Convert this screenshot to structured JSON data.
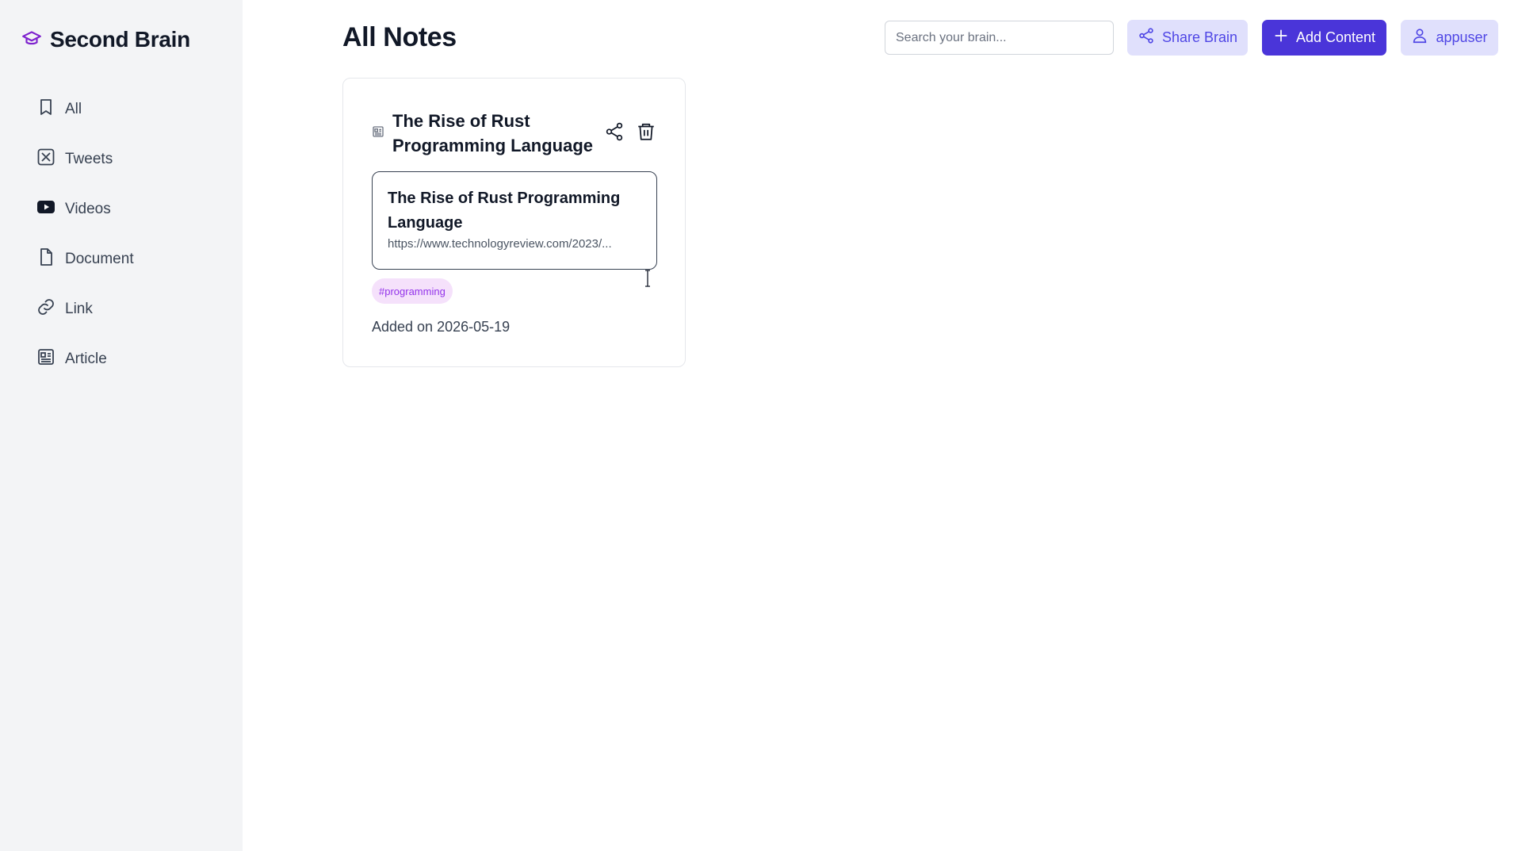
{
  "sidebar": {
    "brand": "Second Brain",
    "items": [
      {
        "label": "All",
        "icon": "bookmark-icon"
      },
      {
        "label": "Tweets",
        "icon": "x-twitter-icon"
      },
      {
        "label": "Videos",
        "icon": "youtube-icon"
      },
      {
        "label": "Document",
        "icon": "document-icon"
      },
      {
        "label": "Link",
        "icon": "link-icon"
      },
      {
        "label": "Article",
        "icon": "newspaper-icon"
      }
    ]
  },
  "header": {
    "title": "All Notes",
    "search_placeholder": "Search your brain...",
    "search_value": "",
    "share_label": "Share Brain",
    "add_label": "Add Content",
    "user_label": "appuser"
  },
  "notes": [
    {
      "title": "The Rise of Rust Programming Language",
      "type_icon": "article-icon",
      "preview_title": "The Rise of Rust Programming Language",
      "preview_url": "https://www.technologyreview.com/2023/...",
      "tag": "#programming",
      "added": "Added on 2026-05-19"
    }
  ],
  "colors": {
    "accent": "#4a35d9",
    "accent_light": "#e0e0fc",
    "tag_bg": "#f5e1fb",
    "tag_text": "#9333ea",
    "sidebar_bg": "#f3f4f6"
  }
}
